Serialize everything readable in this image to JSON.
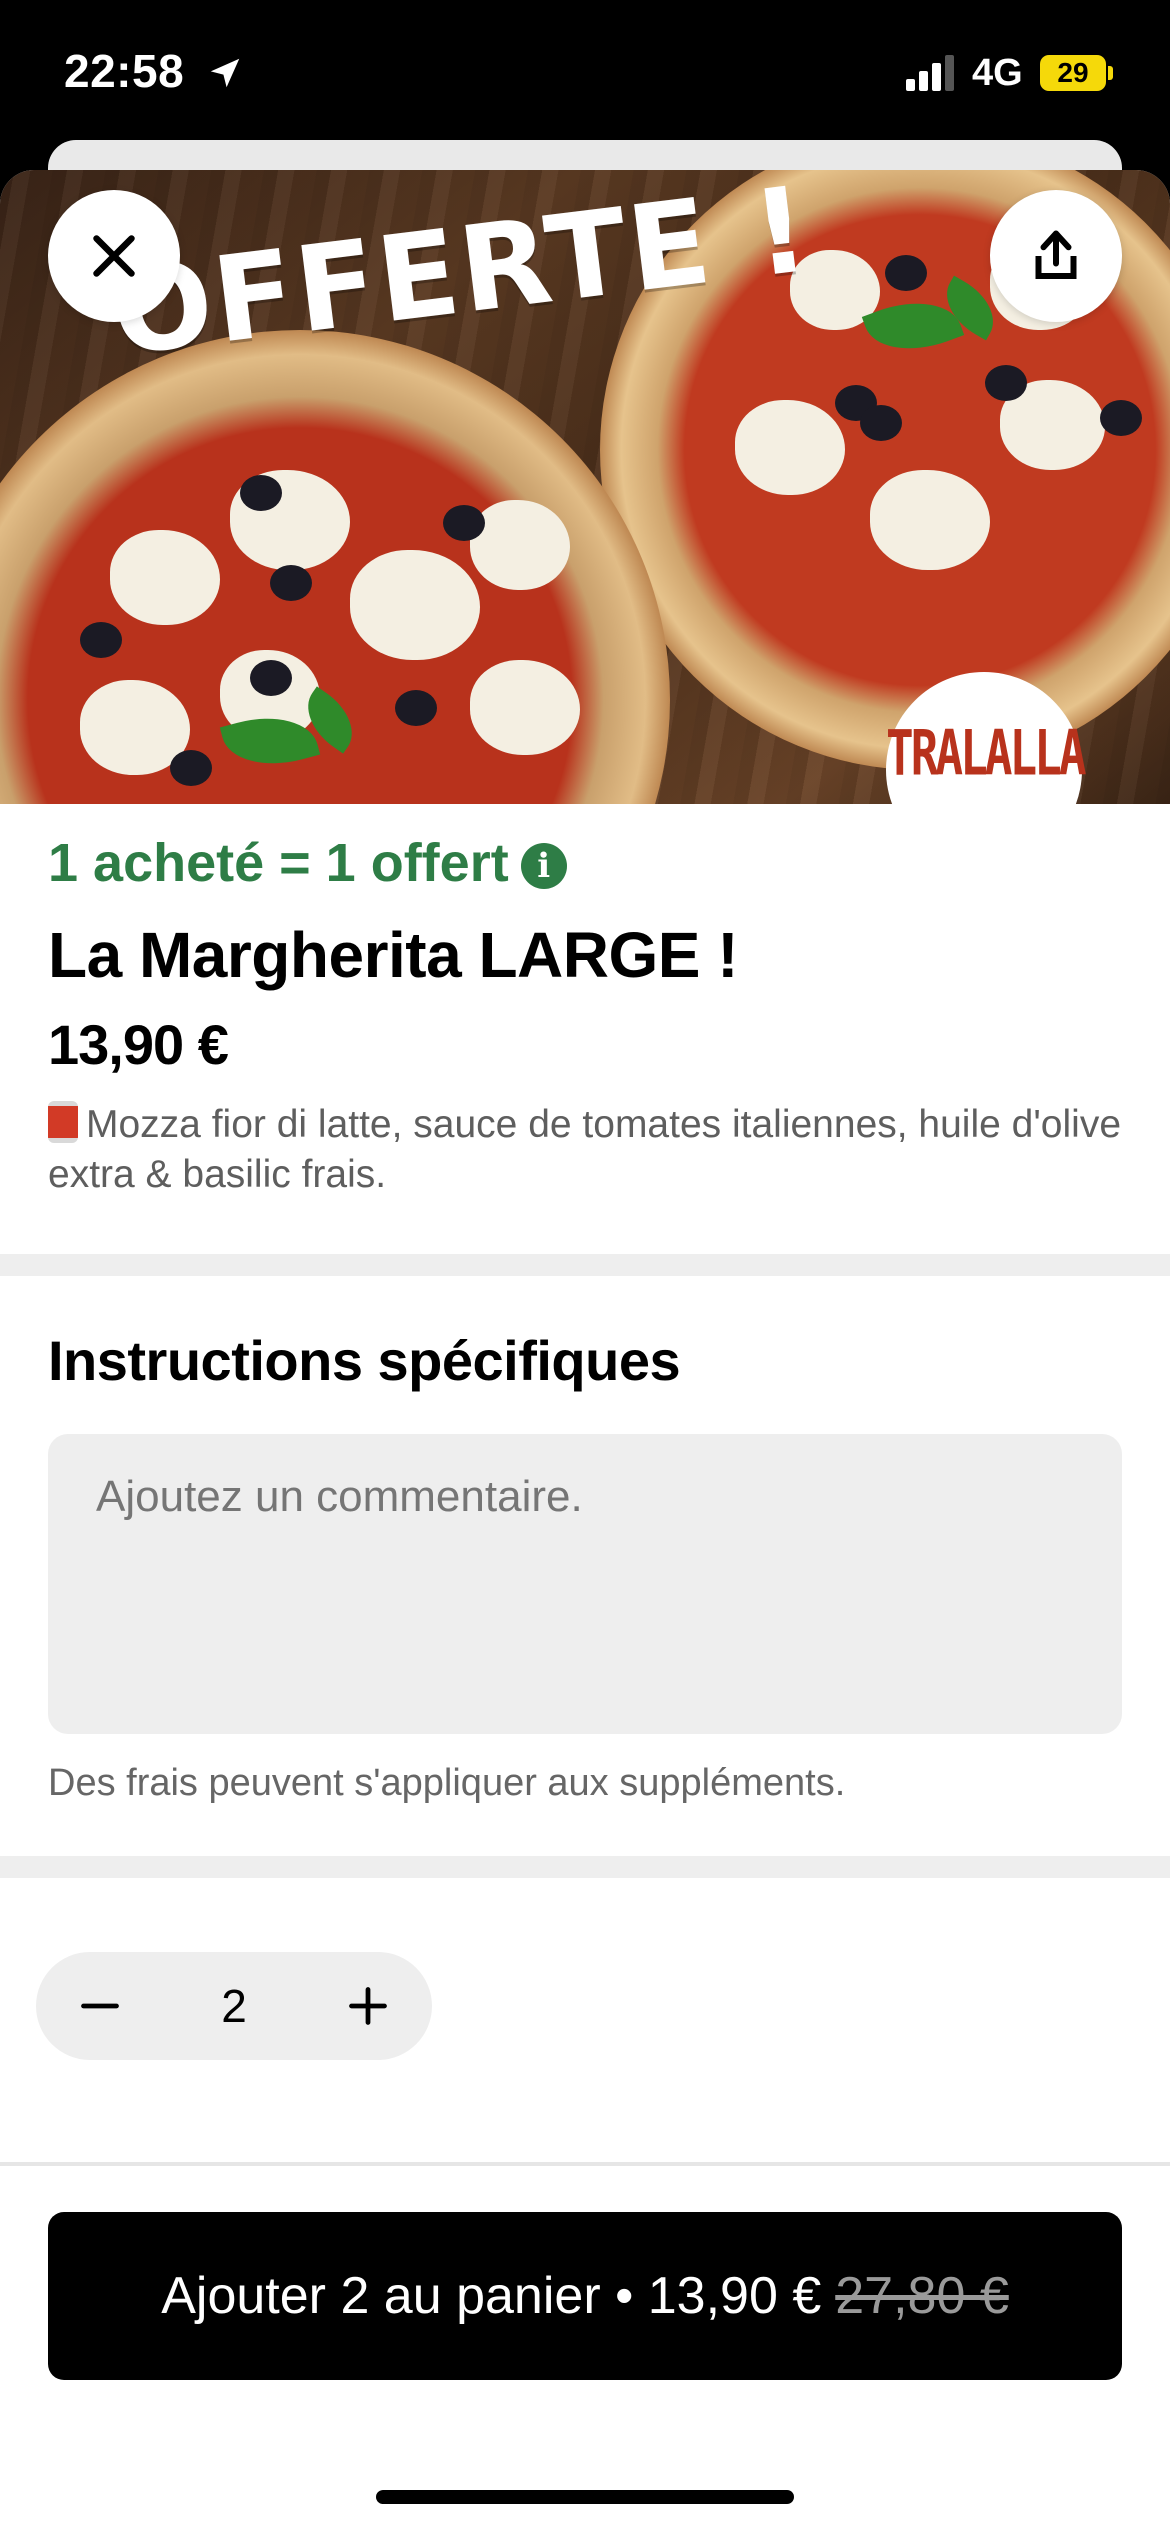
{
  "status_bar": {
    "time": "22:58",
    "network": "4G",
    "battery": "29",
    "icons": [
      "location-arrow-icon",
      "signal-icon"
    ]
  },
  "hero": {
    "banner_text": "OFFERTE !",
    "brand_badge": "TRALALLA",
    "close_icon": "close-icon",
    "share_icon": "share-icon"
  },
  "product": {
    "promo": "1 acheté = 1 offert",
    "promo_icon": "info-icon",
    "title": "La Margherita LARGE !",
    "price": "13,90 €",
    "description_icon": "tomato-can-icon",
    "description": "Mozza fior di latte, sauce de tomates italiennes, huile d'olive extra & basilic frais."
  },
  "instructions": {
    "title": "Instructions spécifiques",
    "placeholder": "Ajoutez un commentaire.",
    "fee_note": "Des frais peuvent s'appliquer aux suppléments."
  },
  "quantity": {
    "value": "2",
    "decrement_icon": "minus-icon",
    "increment_icon": "plus-icon"
  },
  "cart_button": {
    "label": "Ajouter 2 au panier • 13,90 €",
    "old_price": "27,80 €"
  },
  "colors": {
    "promo_green": "#2e7d46",
    "battery_yellow": "#f5d90a",
    "button_black": "#000000"
  }
}
